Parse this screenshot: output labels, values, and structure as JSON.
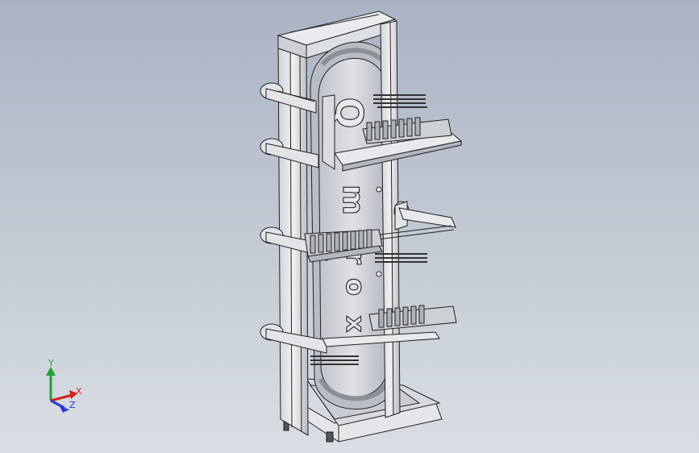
{
  "viewport": {
    "background_top": "#a9b3c3",
    "background_bottom": "#dadee4"
  },
  "model": {
    "name_letters": [
      "Q",
      "m",
      "r",
      "o",
      "x"
    ],
    "colors": {
      "frame": "#e4e6ea",
      "frame_shade": "#bfc3ca",
      "edge": "#202020",
      "belt": "#cfd2d8",
      "metal": "#9aa0aa"
    }
  },
  "triad": {
    "y_label": "Y",
    "x_label": "X",
    "z_label": "Z",
    "y_color": "#1ea03a",
    "x_color": "#d42020",
    "z_color": "#2a3ad6"
  }
}
